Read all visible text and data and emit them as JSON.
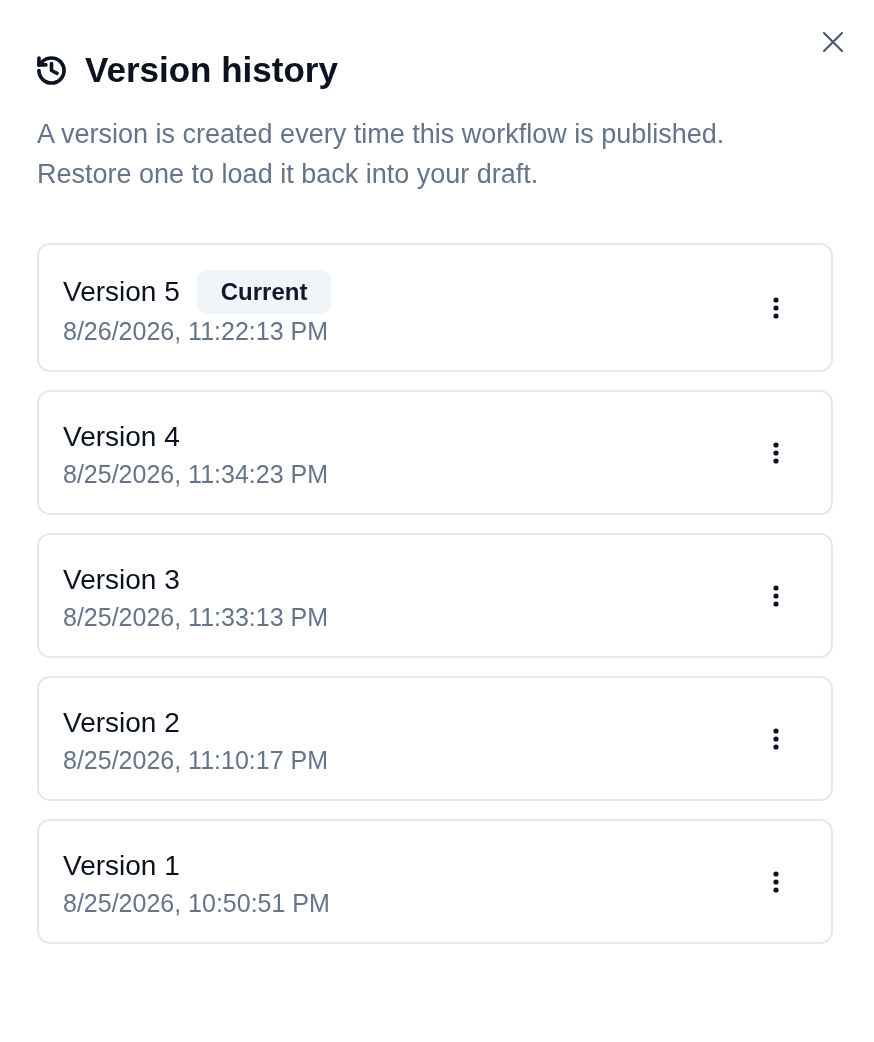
{
  "panel": {
    "title": "Version history",
    "description": "A version is created every time this workflow is published. Restore one to load it back into your draft."
  },
  "versions": [
    {
      "name": "Version 5",
      "badge": "Current",
      "timestamp": "8/26/2026, 11:22:13 PM"
    },
    {
      "name": "Version 4",
      "timestamp": "8/25/2026, 11:34:23 PM"
    },
    {
      "name": "Version 3",
      "timestamp": "8/25/2026, 11:33:13 PM"
    },
    {
      "name": "Version 2",
      "timestamp": "8/25/2026, 11:10:17 PM"
    },
    {
      "name": "Version 1",
      "timestamp": "8/25/2026, 10:50:51 PM"
    }
  ]
}
